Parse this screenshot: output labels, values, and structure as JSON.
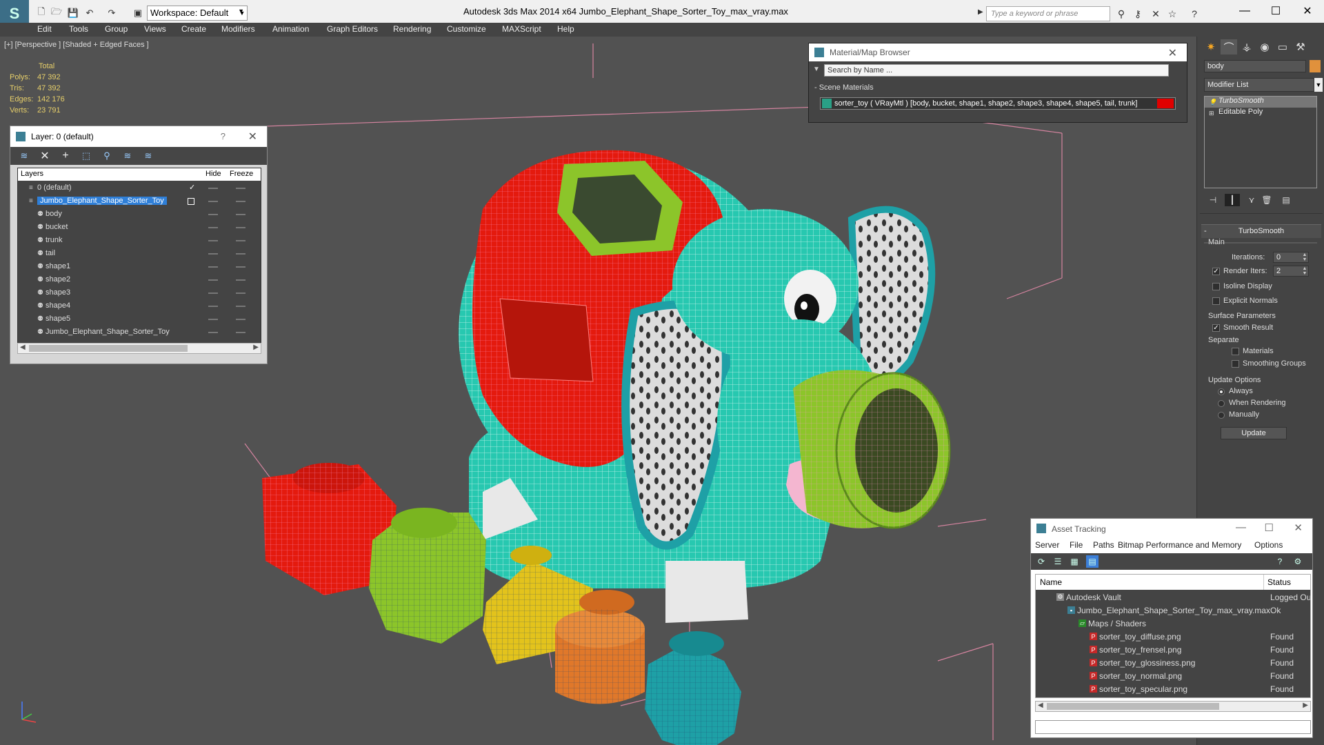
{
  "titlebar": {
    "workspace": "Workspace: Default",
    "app_title": "Autodesk 3ds Max  2014 x64      Jumbo_Elephant_Shape_Sorter_Toy_max_vray.max",
    "search_placeholder": "Type a keyword or phrase"
  },
  "menu": [
    "Edit",
    "Tools",
    "Group",
    "Views",
    "Create",
    "Modifiers",
    "Animation",
    "Graph Editors",
    "Rendering",
    "Customize",
    "MAXScript",
    "Help"
  ],
  "viewport": {
    "label": "[+] [Perspective ] [Shaded + Edged Faces ]",
    "stats": {
      "header": "Total",
      "rows": [
        {
          "label": "Polys:",
          "value": "47 392"
        },
        {
          "label": "Tris:",
          "value": "47 392"
        },
        {
          "label": "Edges:",
          "value": "142 176"
        },
        {
          "label": "Verts:",
          "value": "23 791"
        }
      ]
    },
    "colors": {
      "red": "#e41a0e",
      "teal": "#27c8b0",
      "green": "#8cc52a",
      "yellow": "#e3c31c",
      "orange": "#e0782a",
      "cyan": "#1ea0a6",
      "background": "#525252"
    }
  },
  "layer_window": {
    "title": "Layer: 0 (default)",
    "help": "?",
    "columns": {
      "layers": "Layers",
      "hide": "Hide",
      "freeze": "Freeze"
    },
    "rows": [
      {
        "name": "0 (default)",
        "indent": 1,
        "checked": true
      },
      {
        "name": "Jumbo_Elephant_Shape_Sorter_Toy",
        "indent": 1,
        "selected": true
      },
      {
        "name": "body",
        "indent": 2
      },
      {
        "name": "bucket",
        "indent": 2
      },
      {
        "name": "trunk",
        "indent": 2
      },
      {
        "name": "tail",
        "indent": 2
      },
      {
        "name": "shape1",
        "indent": 2
      },
      {
        "name": "shape2",
        "indent": 2
      },
      {
        "name": "shape3",
        "indent": 2
      },
      {
        "name": "shape4",
        "indent": 2
      },
      {
        "name": "shape5",
        "indent": 2
      },
      {
        "name": "Jumbo_Elephant_Shape_Sorter_Toy",
        "indent": 2
      }
    ]
  },
  "material_browser": {
    "title": "Material/Map Browser",
    "search_placeholder": "Search by Name ...",
    "section": "- Scene Materials",
    "item": "sorter_toy  ( VRayMtl )  [body, bucket, shape1, shape2, shape3, shape4, shape5, tail, trunk]",
    "swatch_color": "#e00000"
  },
  "command_panel": {
    "object_name": "body",
    "object_color": "#e0913c",
    "modifier_list": "Modifier List",
    "stack": [
      {
        "label": "TurboSmooth",
        "active": true
      },
      {
        "label": "Editable Poly",
        "active": false
      }
    ],
    "rollout_title": "TurboSmooth",
    "main_label": "Main",
    "iterations_label": "Iterations:",
    "iterations_value": "0",
    "render_iters_label": "Render Iters:",
    "render_iters_value": "2",
    "isoline_label": "Isoline Display",
    "explicit_normals_label": "Explicit Normals",
    "surface_params_label": "Surface Parameters",
    "smooth_result_label": "Smooth Result",
    "separate_label": "Separate",
    "materials_label": "Materials",
    "smoothing_groups_label": "Smoothing Groups",
    "update_options_label": "Update Options",
    "always_label": "Always",
    "when_rendering_label": "When Rendering",
    "manually_label": "Manually",
    "update_button": "Update"
  },
  "asset_tracking": {
    "title": "Asset Tracking",
    "menu": [
      "Server",
      "File",
      "Paths",
      "Bitmap Performance and Memory",
      "Options"
    ],
    "columns": {
      "name": "Name",
      "status": "Status"
    },
    "rows": [
      {
        "name": "Autodesk Vault",
        "status": "Logged Ou",
        "indent": 1,
        "icon": "vault"
      },
      {
        "name": "Jumbo_Elephant_Shape_Sorter_Toy_max_vray.max",
        "status": "Ok",
        "indent": 2,
        "icon": "max"
      },
      {
        "name": "Maps / Shaders",
        "status": "",
        "indent": 3,
        "icon": "maps"
      },
      {
        "name": "sorter_toy_diffuse.png",
        "status": "Found",
        "indent": 4,
        "icon": "png"
      },
      {
        "name": "sorter_toy_frensel.png",
        "status": "Found",
        "indent": 4,
        "icon": "png"
      },
      {
        "name": "sorter_toy_glossiness.png",
        "status": "Found",
        "indent": 4,
        "icon": "png"
      },
      {
        "name": "sorter_toy_normal.png",
        "status": "Found",
        "indent": 4,
        "icon": "png"
      },
      {
        "name": "sorter_toy_specular.png",
        "status": "Found",
        "indent": 4,
        "icon": "png"
      }
    ]
  }
}
